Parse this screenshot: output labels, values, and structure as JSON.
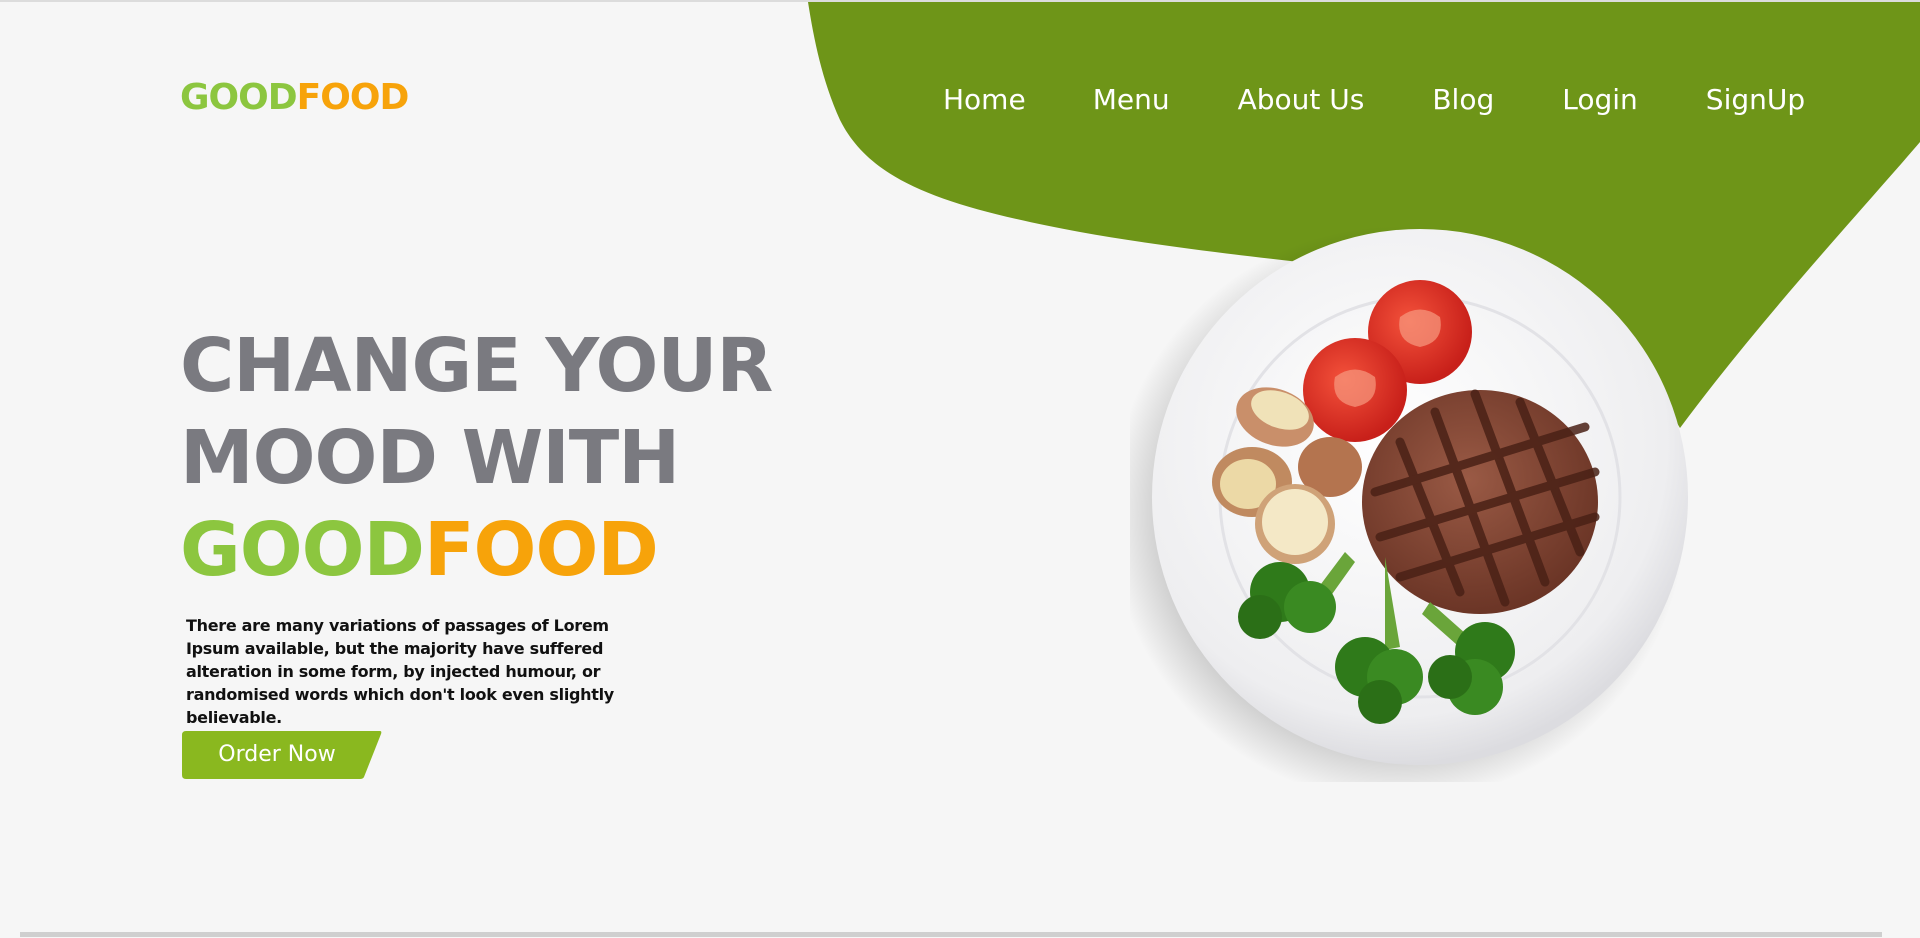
{
  "brand": {
    "logo_part1": "GOOD",
    "logo_part2": "FOOD",
    "colors": {
      "green": "#8cc63f",
      "orange": "#f7a30a",
      "blob_green": "#6e9518",
      "headline_gray": "#7a7a80",
      "background": "#f6f6f6"
    }
  },
  "nav": {
    "items": [
      {
        "label": "Home",
        "icon": ""
      },
      {
        "label": "Menu",
        "icon": ""
      },
      {
        "label": "About Us",
        "icon": ""
      },
      {
        "label": "Blog",
        "icon": ""
      },
      {
        "label": "Login",
        "icon": ""
      },
      {
        "label": "SignUp",
        "icon": ""
      }
    ]
  },
  "hero": {
    "line1": "CHANGE YOUR",
    "line2": "MOOD WITH",
    "brand_part1": "GOOD",
    "brand_part2": "FOOD",
    "description": "There are many variations of passages of Lorem Ipsum available, but the majority have suffered alteration in some form, by injected humour, or randomised words which don't look even slightly believable.",
    "cta_label": "Order Now",
    "image": "plate-steak-vegetables"
  }
}
